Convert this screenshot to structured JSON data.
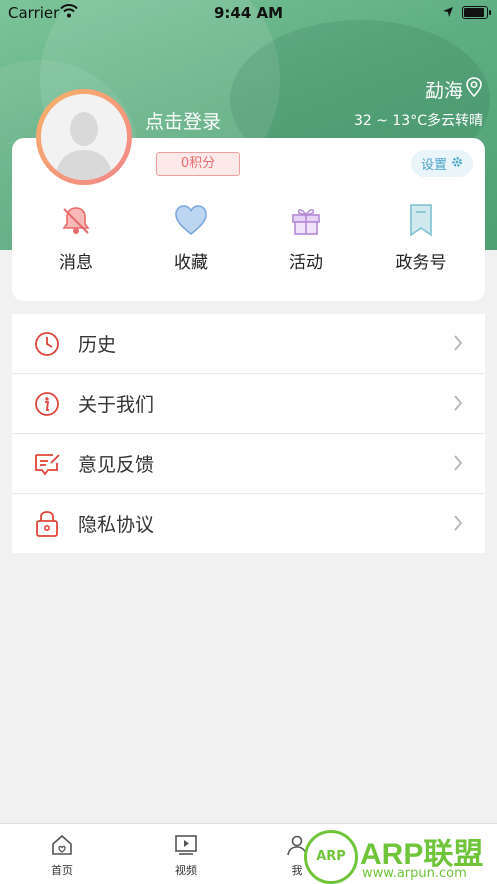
{
  "status_bar": {
    "carrier": "Carrier",
    "time": "9:44 AM"
  },
  "header": {
    "city": "勐海",
    "weather": "32 ~ 13°C多云转晴",
    "login_label": "点击登录",
    "points_label": "0积分",
    "settings_label": "设置"
  },
  "quick_actions": [
    {
      "label": "消息",
      "icon": "bell-off-icon"
    },
    {
      "label": "收藏",
      "icon": "heart-icon"
    },
    {
      "label": "活动",
      "icon": "gift-icon"
    },
    {
      "label": "政务号",
      "icon": "bookmark-icon"
    }
  ],
  "menu": [
    {
      "label": "历史",
      "icon": "clock-icon"
    },
    {
      "label": "关于我们",
      "icon": "info-icon"
    },
    {
      "label": "意见反馈",
      "icon": "feedback-icon"
    },
    {
      "label": "隐私协议",
      "icon": "lock-icon"
    }
  ],
  "tabbar": [
    {
      "label": "首页",
      "icon": "home-icon"
    },
    {
      "label": "视频",
      "icon": "video-icon"
    },
    {
      "label": "我",
      "icon": "user-icon"
    }
  ],
  "watermark": {
    "logo": "ARP",
    "title": "ARP联盟",
    "url": "www.arpun.com"
  },
  "colors": {
    "accent_green": "#5fae83",
    "red_icon": "#e0443a",
    "points_red": "#ee6b6b",
    "settings_blue": "#4aa3c8"
  }
}
